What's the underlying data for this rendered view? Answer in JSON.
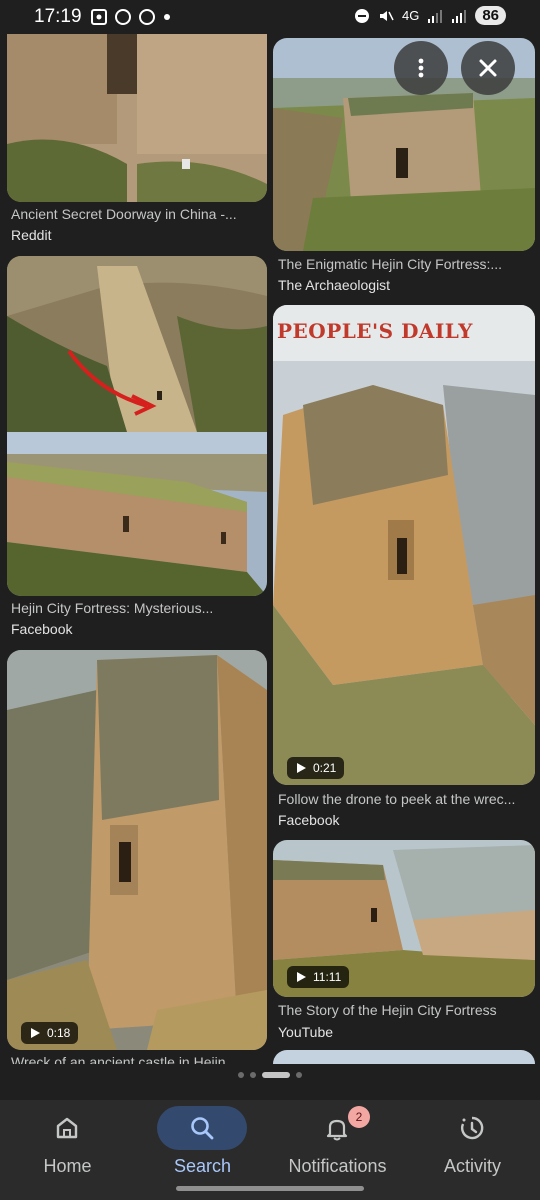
{
  "status_bar": {
    "time": "17:19",
    "battery": "86",
    "network": "4G"
  },
  "results": [
    {
      "title": "Ancient Secret Doorway in China -...",
      "source": "Reddit"
    },
    {
      "title": "The Enigmatic Hejin City Fortress:...",
      "source": "The Archaeologist"
    },
    {
      "title": "Hejin City Fortress: Mysterious...",
      "source": "Facebook"
    },
    {
      "title": "Follow the drone to peek at the wrec...",
      "source": "Facebook",
      "duration": "0:21",
      "overlay_text": "PEOPLE'S DAILY"
    },
    {
      "title": "The Story of the Hejin City Fortress",
      "source": "YouTube",
      "duration": "11:11"
    },
    {
      "title": "Wreck of an ancient castle in Hejin...",
      "duration": "0:18"
    }
  ],
  "overlay_buttons": {
    "more": "more-vert-icon",
    "close": "close-icon"
  },
  "bottom_nav": [
    {
      "label": "Home",
      "icon": "home-icon"
    },
    {
      "label": "Search",
      "icon": "search-icon",
      "active": true
    },
    {
      "label": "Notifications",
      "icon": "bell-icon",
      "badge": "2"
    },
    {
      "label": "Activity",
      "icon": "activity-icon"
    }
  ],
  "colors": {
    "background": "#1f1f1f",
    "nav_background": "#2b2b2b",
    "active_accent": "#a8c7fa",
    "active_pill": "#334a6e",
    "badge": "#f2a7a3"
  }
}
